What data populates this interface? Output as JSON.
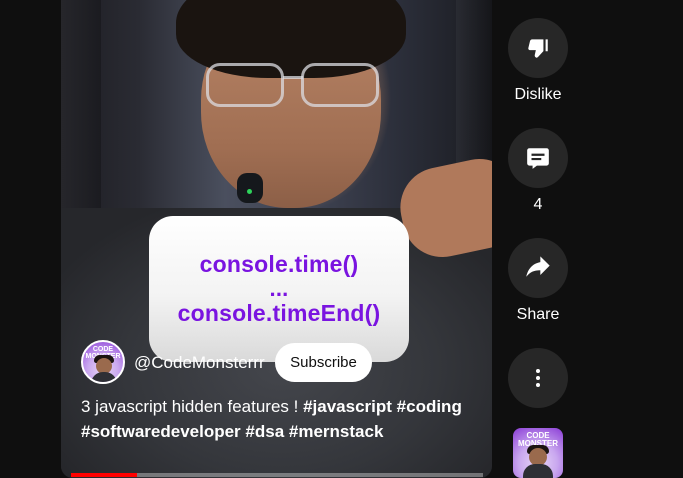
{
  "overlay": {
    "line1": "console.time()",
    "line2": "...",
    "line3": "console.timeEnd()"
  },
  "channel": {
    "name": "@CodeMonsterrr",
    "avatar_text": "CODE MONSTER",
    "subscribe_label": "Subscribe"
  },
  "video": {
    "title_prefix": "3 javascript hidden features ! ",
    "hashtags": [
      "#javascript",
      "#coding",
      "#softwaredeveloper",
      "#dsa",
      "#mernstack"
    ],
    "progress_fraction": 0.16
  },
  "actions": {
    "dislike": {
      "label": "Dislike",
      "icon": "thumbs-down-icon"
    },
    "comments": {
      "label": "4",
      "icon": "comment-icon"
    },
    "share": {
      "label": "Share",
      "icon": "share-icon"
    },
    "more": {
      "icon": "more-vertical-icon"
    }
  },
  "colors": {
    "background": "#0f0f0f",
    "overlay_text": "#7a14e0",
    "progress": "#ff0000",
    "action_button": "#272727"
  }
}
